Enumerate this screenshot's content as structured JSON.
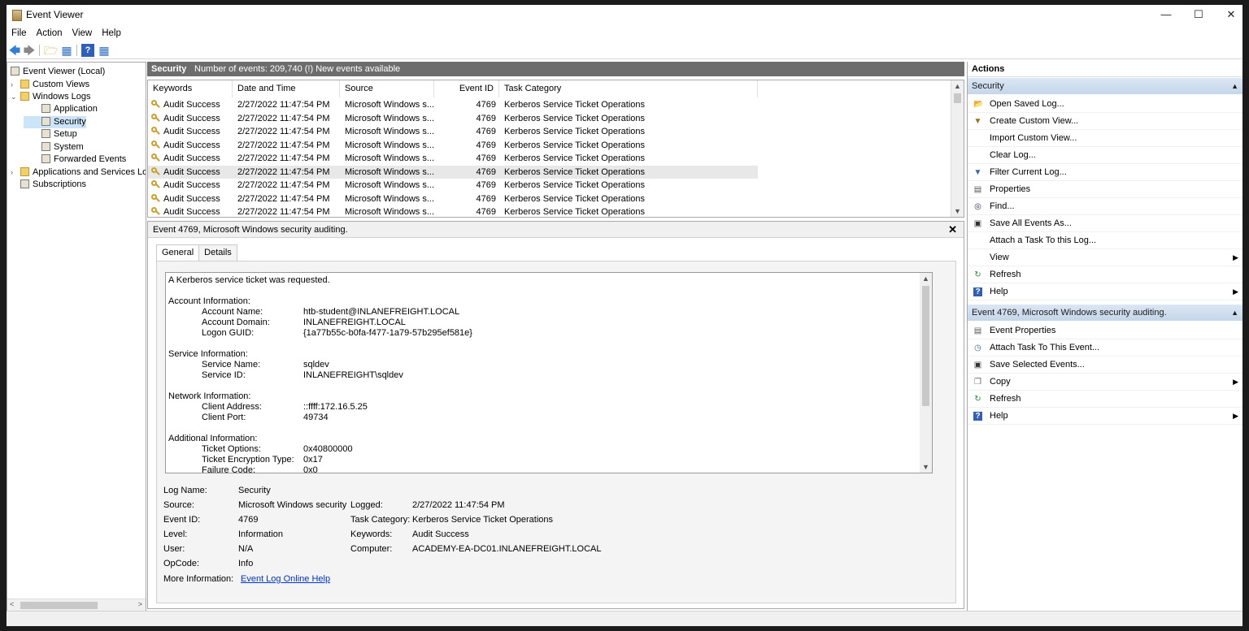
{
  "window": {
    "title": "Event Viewer"
  },
  "menu": [
    "File",
    "Action",
    "View",
    "Help"
  ],
  "tree": [
    {
      "label": "Event Viewer (Local)",
      "level": 0,
      "expander": "",
      "icon": "event-viewer-icon"
    },
    {
      "label": "Custom Views",
      "level": 1,
      "expander": ">",
      "icon": "folder-icon"
    },
    {
      "label": "Windows Logs",
      "level": 1,
      "expander": "v",
      "icon": "folder-icon"
    },
    {
      "label": "Application",
      "level": 2,
      "expander": "",
      "icon": "log-icon"
    },
    {
      "label": "Security",
      "level": 2,
      "expander": "",
      "icon": "log-icon",
      "selected": true
    },
    {
      "label": "Setup",
      "level": 2,
      "expander": "",
      "icon": "log-icon"
    },
    {
      "label": "System",
      "level": 2,
      "expander": "",
      "icon": "log-icon"
    },
    {
      "label": "Forwarded Events",
      "level": 2,
      "expander": "",
      "icon": "log-icon"
    },
    {
      "label": "Applications and Services Lo",
      "level": 1,
      "expander": ">",
      "icon": "folder-icon"
    },
    {
      "label": "Subscriptions",
      "level": 1,
      "expander": "",
      "icon": "subscriptions-icon"
    }
  ],
  "log_header": {
    "name": "Security",
    "info": "Number of events: 209,740 (!) New events available"
  },
  "columns": [
    "Keywords",
    "Date and Time",
    "Source",
    "Event ID",
    "Task Category"
  ],
  "rows": [
    {
      "keywords": "Audit Success",
      "date": "2/27/2022 11:47:54 PM",
      "source": "Microsoft Windows s...",
      "event_id": "4769",
      "task": "Kerberos Service Ticket Operations"
    },
    {
      "keywords": "Audit Success",
      "date": "2/27/2022 11:47:54 PM",
      "source": "Microsoft Windows s...",
      "event_id": "4769",
      "task": "Kerberos Service Ticket Operations"
    },
    {
      "keywords": "Audit Success",
      "date": "2/27/2022 11:47:54 PM",
      "source": "Microsoft Windows s...",
      "event_id": "4769",
      "task": "Kerberos Service Ticket Operations"
    },
    {
      "keywords": "Audit Success",
      "date": "2/27/2022 11:47:54 PM",
      "source": "Microsoft Windows s...",
      "event_id": "4769",
      "task": "Kerberos Service Ticket Operations"
    },
    {
      "keywords": "Audit Success",
      "date": "2/27/2022 11:47:54 PM",
      "source": "Microsoft Windows s...",
      "event_id": "4769",
      "task": "Kerberos Service Ticket Operations"
    },
    {
      "keywords": "Audit Success",
      "date": "2/27/2022 11:47:54 PM",
      "source": "Microsoft Windows s...",
      "event_id": "4769",
      "task": "Kerberos Service Ticket Operations",
      "highlighted": true
    },
    {
      "keywords": "Audit Success",
      "date": "2/27/2022 11:47:54 PM",
      "source": "Microsoft Windows s...",
      "event_id": "4769",
      "task": "Kerberos Service Ticket Operations"
    },
    {
      "keywords": "Audit Success",
      "date": "2/27/2022 11:47:54 PM",
      "source": "Microsoft Windows s...",
      "event_id": "4769",
      "task": "Kerberos Service Ticket Operations"
    },
    {
      "keywords": "Audit Success",
      "date": "2/27/2022 11:47:54 PM",
      "source": "Microsoft Windows s...",
      "event_id": "4769",
      "task": "Kerberos Service Ticket Operations"
    }
  ],
  "detail": {
    "header": "Event 4769, Microsoft Windows security auditing.",
    "tabs": [
      "General",
      "Details"
    ],
    "message": [
      {
        "text": "A Kerberos service ticket was requested.",
        "indent": 0
      },
      {
        "text": "",
        "indent": 0
      },
      {
        "text": "Account Information:",
        "indent": 0
      },
      {
        "text": "Account Name:",
        "value": "htb-student@INLANEFREIGHT.LOCAL",
        "indent": 1
      },
      {
        "text": "Account Domain:",
        "value": "INLANEFREIGHT.LOCAL",
        "indent": 1
      },
      {
        "text": "Logon GUID:",
        "value": "{1a77b55c-b0fa-f477-1a79-57b295ef581e}",
        "indent": 1
      },
      {
        "text": "",
        "indent": 0
      },
      {
        "text": "Service Information:",
        "indent": 0
      },
      {
        "text": "Service Name:",
        "value": "sqldev",
        "indent": 1
      },
      {
        "text": "Service ID:",
        "value": "INLANEFREIGHT\\sqldev",
        "indent": 1
      },
      {
        "text": "",
        "indent": 0
      },
      {
        "text": "Network Information:",
        "indent": 0
      },
      {
        "text": "Client Address:",
        "value": "::ffff:172.16.5.25",
        "indent": 1
      },
      {
        "text": "Client Port:",
        "value": "49734",
        "indent": 1
      },
      {
        "text": "",
        "indent": 0
      },
      {
        "text": "Additional Information:",
        "indent": 0
      },
      {
        "text": "Ticket Options:",
        "value": "0x40800000",
        "indent": 1
      },
      {
        "text": "Ticket Encryption Type:",
        "value": "0x17",
        "indent": 1
      },
      {
        "text": "Failure Code:",
        "value": "0x0",
        "indent": 1
      }
    ],
    "props_left": [
      {
        "label": "Log Name:",
        "value": "Security"
      },
      {
        "label": "Source:",
        "value": "Microsoft Windows security"
      },
      {
        "label": "Event ID:",
        "value": "4769"
      },
      {
        "label": "Level:",
        "value": "Information"
      },
      {
        "label": "User:",
        "value": "N/A"
      },
      {
        "label": "OpCode:",
        "value": "Info"
      }
    ],
    "props_right": [
      {
        "label": "Logged:",
        "value": "2/27/2022 11:47:54 PM"
      },
      {
        "label": "Task Category:",
        "value": "Kerberos Service Ticket Operations"
      },
      {
        "label": "Keywords:",
        "value": "Audit Success"
      },
      {
        "label": "Computer:",
        "value": "ACADEMY-EA-DC01.INLANEFREIGHT.LOCAL"
      }
    ],
    "more_info_label": "More Information:",
    "more_info_link": "Event Log Online Help"
  },
  "actions": {
    "title": "Actions",
    "sections": [
      {
        "title": "Security",
        "items": [
          {
            "label": "Open Saved Log...",
            "icon": "open-folder-icon",
            "submenu": false
          },
          {
            "label": "Create Custom View...",
            "icon": "funnel-icon",
            "submenu": false
          },
          {
            "label": "Import Custom View...",
            "icon": "",
            "submenu": false
          },
          {
            "label": "Clear Log...",
            "icon": "",
            "submenu": false
          },
          {
            "label": "Filter Current Log...",
            "icon": "filter-icon",
            "submenu": false
          },
          {
            "label": "Properties",
            "icon": "properties-icon",
            "submenu": false
          },
          {
            "label": "Find...",
            "icon": "binoculars-icon",
            "submenu": false
          },
          {
            "label": "Save All Events As...",
            "icon": "save-icon",
            "submenu": false
          },
          {
            "label": "Attach a Task To this Log...",
            "icon": "",
            "submenu": false
          },
          {
            "label": "View",
            "icon": "",
            "submenu": true
          },
          {
            "label": "Refresh",
            "icon": "refresh-icon",
            "submenu": false
          },
          {
            "label": "Help",
            "icon": "help-icon",
            "submenu": true
          }
        ]
      },
      {
        "title": "Event 4769, Microsoft Windows security auditing.",
        "items": [
          {
            "label": "Event Properties",
            "icon": "properties-icon",
            "submenu": false
          },
          {
            "label": "Attach Task To This Event...",
            "icon": "task-icon",
            "submenu": false
          },
          {
            "label": "Save Selected Events...",
            "icon": "save-icon",
            "submenu": false
          },
          {
            "label": "Copy",
            "icon": "copy-icon",
            "submenu": true
          },
          {
            "label": "Refresh",
            "icon": "refresh-icon",
            "submenu": false
          },
          {
            "label": "Help",
            "icon": "help-icon",
            "submenu": true
          }
        ]
      }
    ]
  }
}
